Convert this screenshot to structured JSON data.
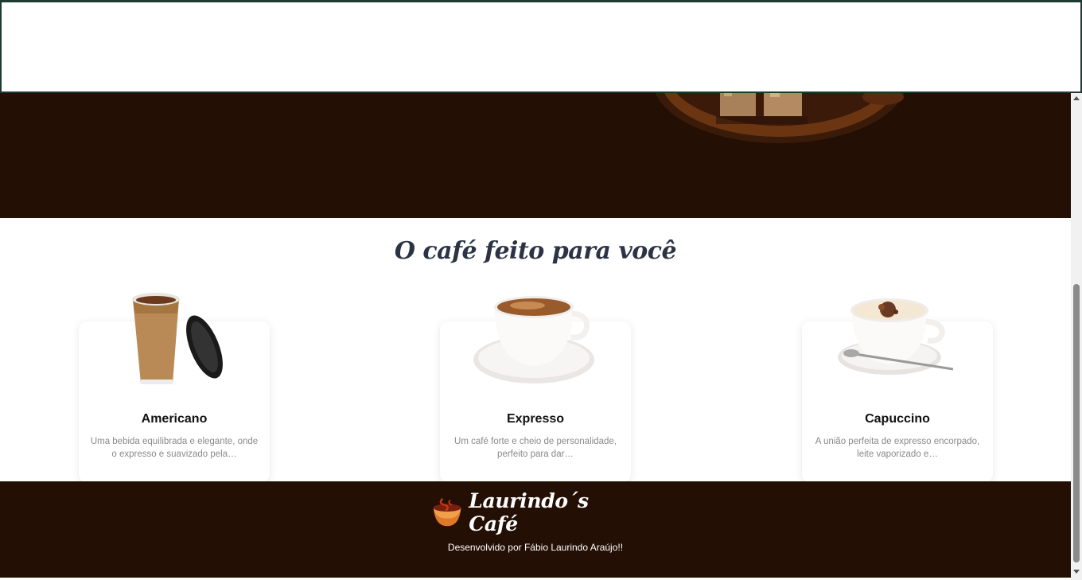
{
  "products": {
    "title": "O café feito para você",
    "items": [
      {
        "name": "Americano",
        "description": "Uma bebida equilibrada e elegante, onde o expresso e suavizado pela…",
        "image_icon": "paper-cup-icon"
      },
      {
        "name": "Expresso",
        "description": "Um café forte e cheio de personalidade, perfeito para dar…",
        "image_icon": "espresso-cup-icon"
      },
      {
        "name": "Capuccino",
        "description": "A união perfeita de expresso encorpado, leite vaporizado e…",
        "image_icon": "cappuccino-cup-icon"
      }
    ]
  },
  "footer": {
    "brand": "Laurindo´s Café",
    "credit": "Desenvolvido por Fábio Laurindo Araújo!!"
  },
  "colors": {
    "dark_brown": "#240f05",
    "title_color": "#2b3344",
    "header_border": "#1f3a33"
  }
}
